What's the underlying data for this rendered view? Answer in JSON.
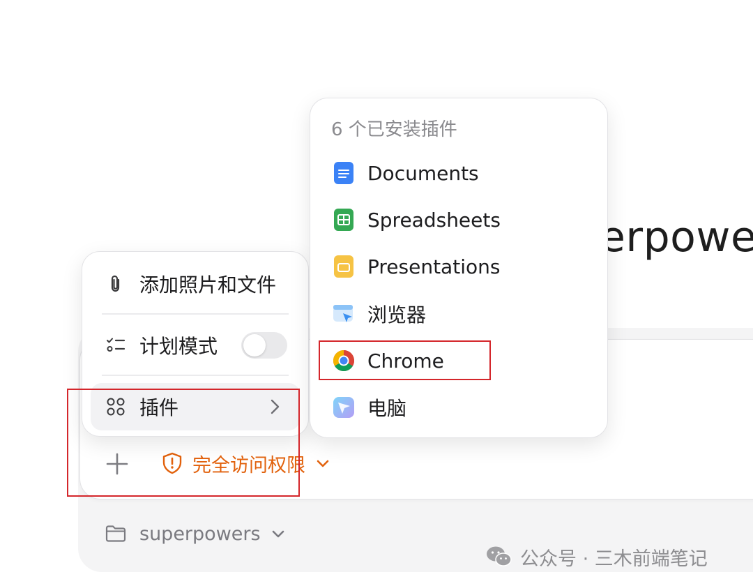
{
  "background": {
    "heading_fragment": "erpowe"
  },
  "menu": {
    "items": [
      {
        "label": "添加照片和文件",
        "icon": "paperclip-icon"
      },
      {
        "label": "计划模式",
        "icon": "plan-list-icon",
        "toggle_on": false
      },
      {
        "label": "插件",
        "icon": "plugins-grid-icon",
        "has_submenu": true
      }
    ]
  },
  "submenu": {
    "title": "6 个已安装插件",
    "plugins": [
      {
        "label": "Documents",
        "icon": "documents-icon",
        "color": "#3b82f6"
      },
      {
        "label": "Spreadsheets",
        "icon": "spreadsheets-icon",
        "color": "#34a853"
      },
      {
        "label": "Presentations",
        "icon": "presentations-icon",
        "color": "#f4b400"
      },
      {
        "label": "浏览器",
        "icon": "browser-icon",
        "color": "#5aa9f5"
      },
      {
        "label": "Chrome",
        "icon": "chrome-icon"
      },
      {
        "label": "电脑",
        "icon": "computer-icon",
        "color": "#60b8f7"
      }
    ]
  },
  "composer": {
    "access_label": "完全访问权限",
    "access_color": "#e2620d",
    "folder_label": "superpowers"
  },
  "watermark": {
    "text": "公众号 · 三木前端笔记"
  },
  "highlight_color": "#d4262b"
}
